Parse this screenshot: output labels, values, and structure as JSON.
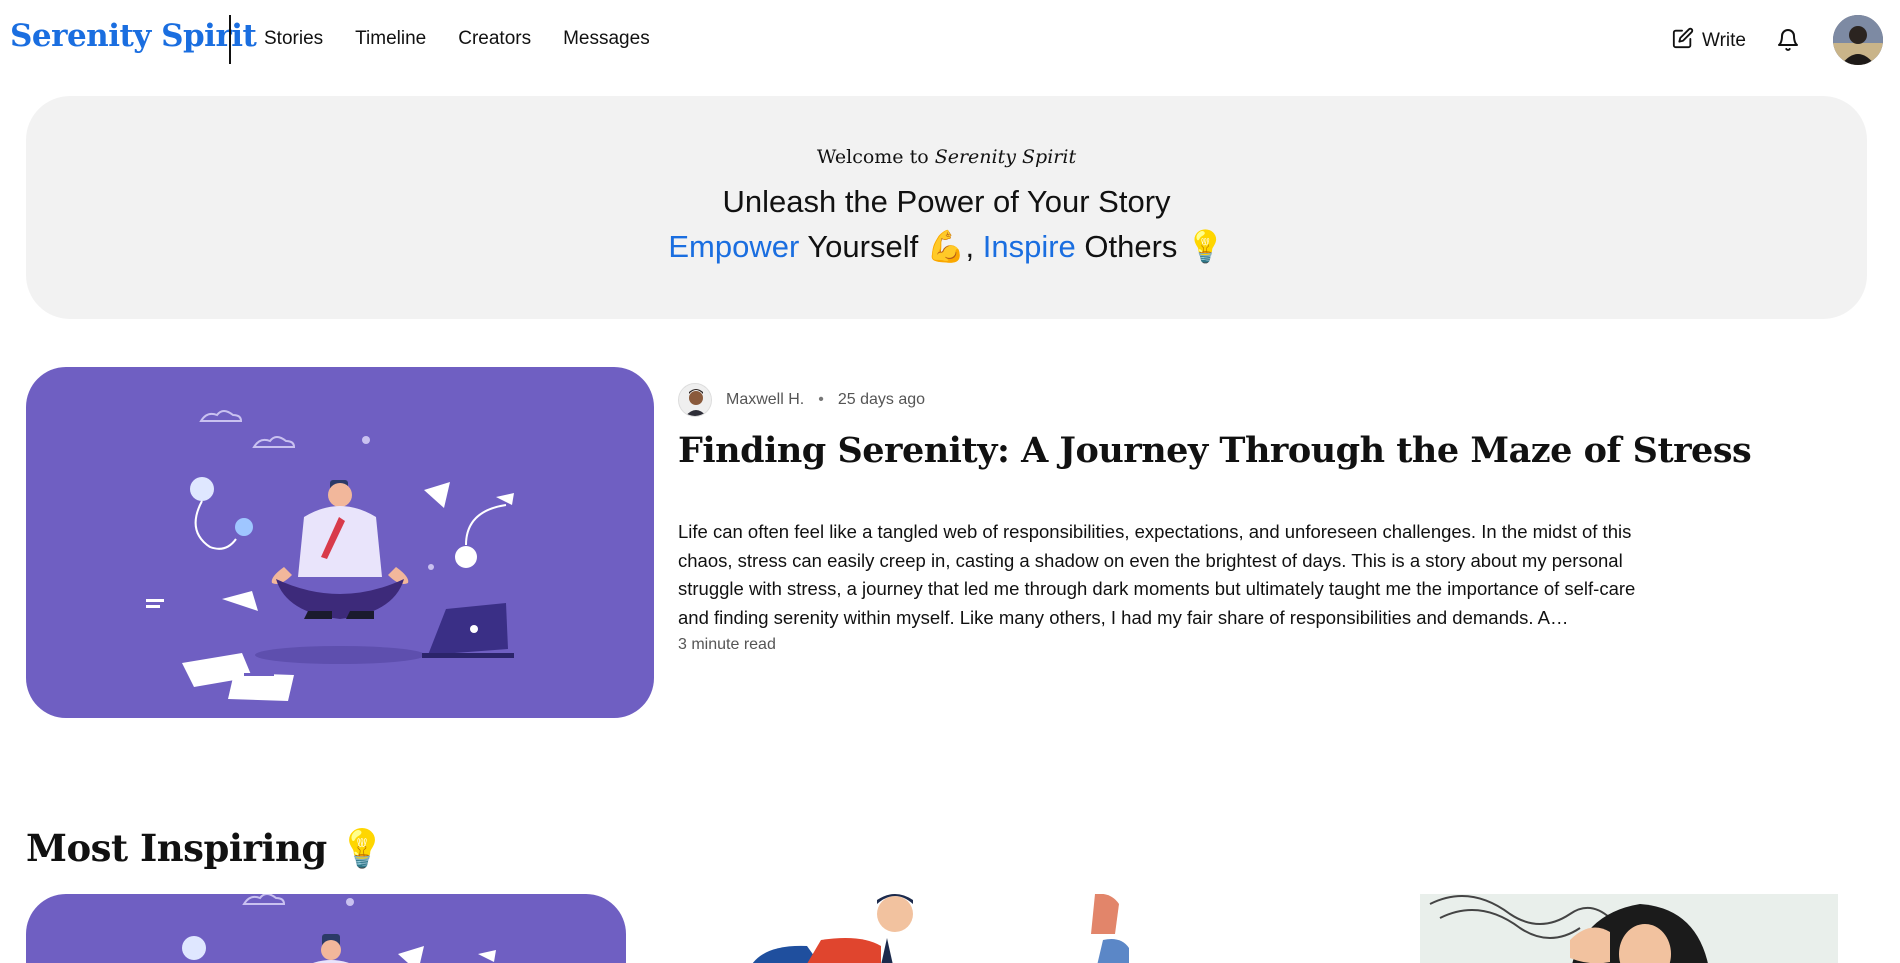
{
  "brand": "Serenity Spirit",
  "nav": {
    "links": [
      "Stories",
      "Timeline",
      "Creators",
      "Messages"
    ],
    "write_label": "Write"
  },
  "hero": {
    "welcome_prefix": "Welcome to",
    "welcome_brand": "Serenity Spirit",
    "title": "Unleash the Power of Your Story",
    "sub_word1": "Empower",
    "sub_text1": "Yourself",
    "sub_emoji1": "💪",
    "sub_comma": ",",
    "sub_word2": "Inspire",
    "sub_text2": "Others",
    "sub_emoji2": "💡"
  },
  "featured": {
    "author": "Maxwell H.",
    "separator": "•",
    "date": "25 days ago",
    "title": "Finding Serenity: A Journey Through the Maze of Stress",
    "excerpt": "Life can often feel like a tangled web of responsibilities, expectations, and unforeseen challenges. In the midst of this chaos, stress can easily creep in, casting a shadow on even the brightest of days. This is a story about my personal struggle with stress, a journey that led me through dark moments but ultimately taught me the importance of self-care and finding serenity within myself. Like many others, I had my fair share of responsibilities and demands. A…",
    "read_time": "3 minute read"
  },
  "section": {
    "title": "Most Inspiring",
    "emoji": "💡"
  },
  "colors": {
    "accent": "#1a6ee0",
    "hero_bg": "#f2f2f2",
    "illustration_bg": "#6f5fc2"
  },
  "icons": {
    "write": "pencil-square-icon",
    "notifications": "bell-icon"
  }
}
